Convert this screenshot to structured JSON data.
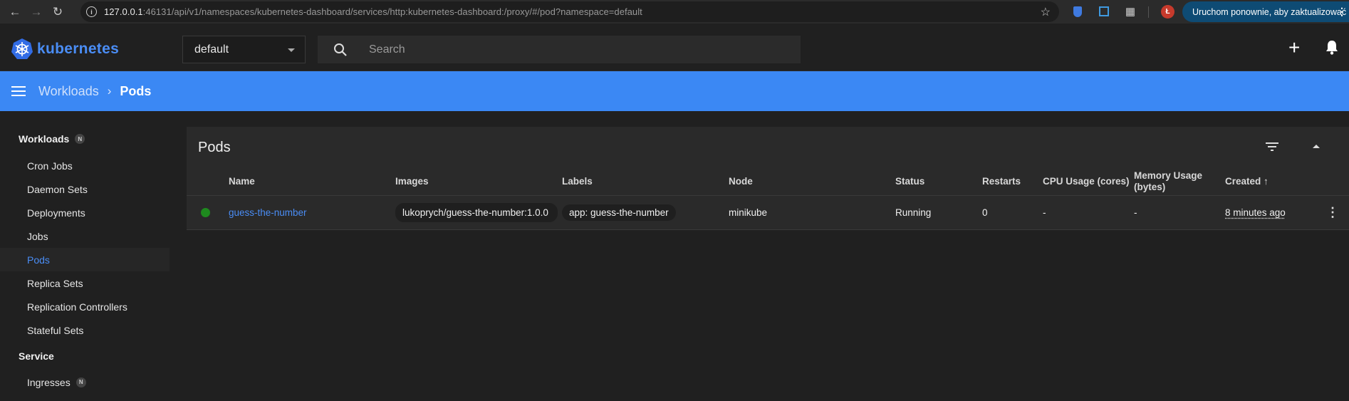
{
  "browser": {
    "url_host": "127.0.0.1",
    "url_rest": ":46131/api/v1/namespaces/kubernetes-dashboard/services/http:kubernetes-dashboard:/proxy/#/pod?namespace=default",
    "profile_initial": "Ł",
    "update_label": "Uruchom ponownie, aby zaktualizować"
  },
  "toolbar": {
    "brand": "kubernetes",
    "namespace": "default",
    "search_placeholder": "Search"
  },
  "breadcrumb": {
    "parent": "Workloads",
    "current": "Pods"
  },
  "sidebar": {
    "groups": [
      {
        "label": "Workloads",
        "badge": "N"
      },
      {
        "label": "Service"
      }
    ],
    "workload_items": [
      "Cron Jobs",
      "Daemon Sets",
      "Deployments",
      "Jobs",
      "Pods",
      "Replica Sets",
      "Replication Controllers",
      "Stateful Sets"
    ],
    "service_items": [
      {
        "label": "Ingresses",
        "badge": "N"
      }
    ],
    "active": "Pods"
  },
  "card": {
    "title": "Pods",
    "columns": [
      "Name",
      "Images",
      "Labels",
      "Node",
      "Status",
      "Restarts",
      "CPU Usage (cores)",
      "Memory Usage (bytes)",
      "Created"
    ],
    "rows": [
      {
        "status_color": "#1e8a1e",
        "name": "guess-the-number",
        "image": "lukoprych/guess-the-number:1.0.0",
        "label": "app: guess-the-number",
        "node": "minikube",
        "status": "Running",
        "restarts": "0",
        "cpu": "-",
        "memory": "-",
        "created": "8 minutes ago"
      }
    ]
  },
  "colors": {
    "accent": "#3b88f4",
    "link": "#4a8df5",
    "running": "#1e8a1e"
  }
}
